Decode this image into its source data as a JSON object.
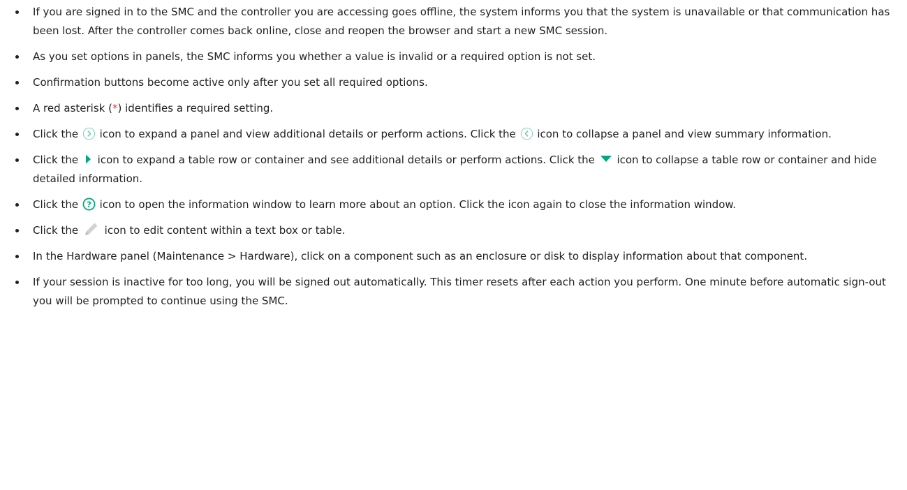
{
  "colors": {
    "text": "#1f1f1f",
    "accent_green": "#01a982",
    "asterisk_red": "#e0342c",
    "pencil_gray": "#d2d2d2"
  },
  "bullets": [
    {
      "text": "If you are signed in to the SMC and the controller you are accessing goes offline, the system informs you that the system is unavailable or that communication has been lost. After the controller comes back online, close and reopen the browser and start a new SMC session."
    },
    {
      "text": "As you set options in panels, the SMC informs you whether a value is invalid or a required option is not set."
    },
    {
      "text": "Confirmation buttons become active only after you set all required options."
    },
    {
      "before": "A red asterisk (",
      "asterisk": "*",
      "after": ") identifies a required setting."
    },
    {
      "before": "Click the ",
      "icon1": "chevron-right-circle-icon",
      "middle": " icon to expand a panel and view additional details or perform actions. Click the ",
      "icon2": "chevron-left-circle-icon",
      "after": " icon to collapse a panel and view summary information."
    },
    {
      "before": "Click the ",
      "icon1": "triangle-right-icon",
      "middle": " icon to expand a table row or container and see additional details or perform actions. Click the ",
      "icon2": "triangle-down-icon",
      "after": " icon to collapse a table row or container and hide detailed information."
    },
    {
      "before": "Click the ",
      "icon": "help-circle-icon",
      "after": " icon to open the information window to learn more about an option. Click the icon again to close the information window."
    },
    {
      "before": "Click the ",
      "icon": "pencil-icon",
      "after": " icon to edit content within a text box or table."
    },
    {
      "text": "In the Hardware panel (Maintenance > Hardware), click on a component such as an enclosure or disk to display information about that component."
    },
    {
      "text": "If your session is inactive for too long, you will be signed out automatically. This timer resets after each action you perform. One minute before automatic sign-out you will be prompted to continue using the SMC."
    }
  ]
}
